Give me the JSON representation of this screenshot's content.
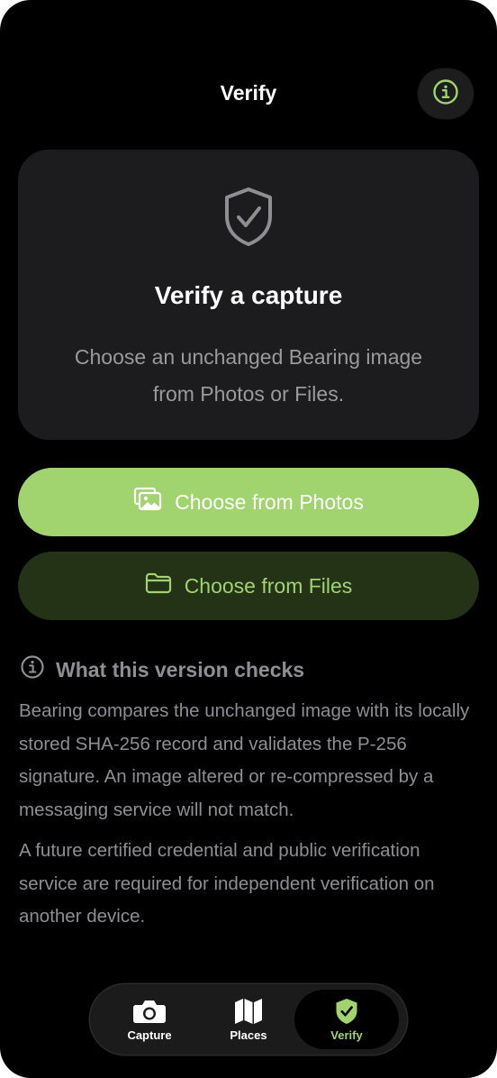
{
  "header": {
    "title": "Verify",
    "info_icon": "info-circle-icon"
  },
  "card": {
    "icon": "shield-check-icon",
    "title": "Verify a capture",
    "subtitle": "Choose an unchanged Bearing image from Photos or Files."
  },
  "actions": {
    "photos_label": "Choose from Photos",
    "photos_icon": "photos-icon",
    "files_label": "Choose from Files",
    "files_icon": "folder-icon"
  },
  "checks": {
    "heading": "What this version checks",
    "heading_icon": "info-circle-icon",
    "paragraph_1": "Bearing compares the unchanged image with its locally stored SHA-256 record and validates the P-256 signature. An image altered or re-compressed by a messaging service will not match.",
    "paragraph_2": "A future certified credential and public verification service are required for independent verification on another device."
  },
  "tabbar": {
    "tabs": [
      {
        "label": "Capture",
        "icon": "camera-icon",
        "selected": false
      },
      {
        "label": "Places",
        "icon": "map-icon",
        "selected": false
      },
      {
        "label": "Verify",
        "icon": "shield-check-icon",
        "selected": true
      }
    ]
  },
  "colors": {
    "accent": "#a1d36f",
    "accent_dark": "#243216",
    "background": "#000000",
    "card": "#1c1c1e",
    "secondary_text": "#8e8e93"
  }
}
